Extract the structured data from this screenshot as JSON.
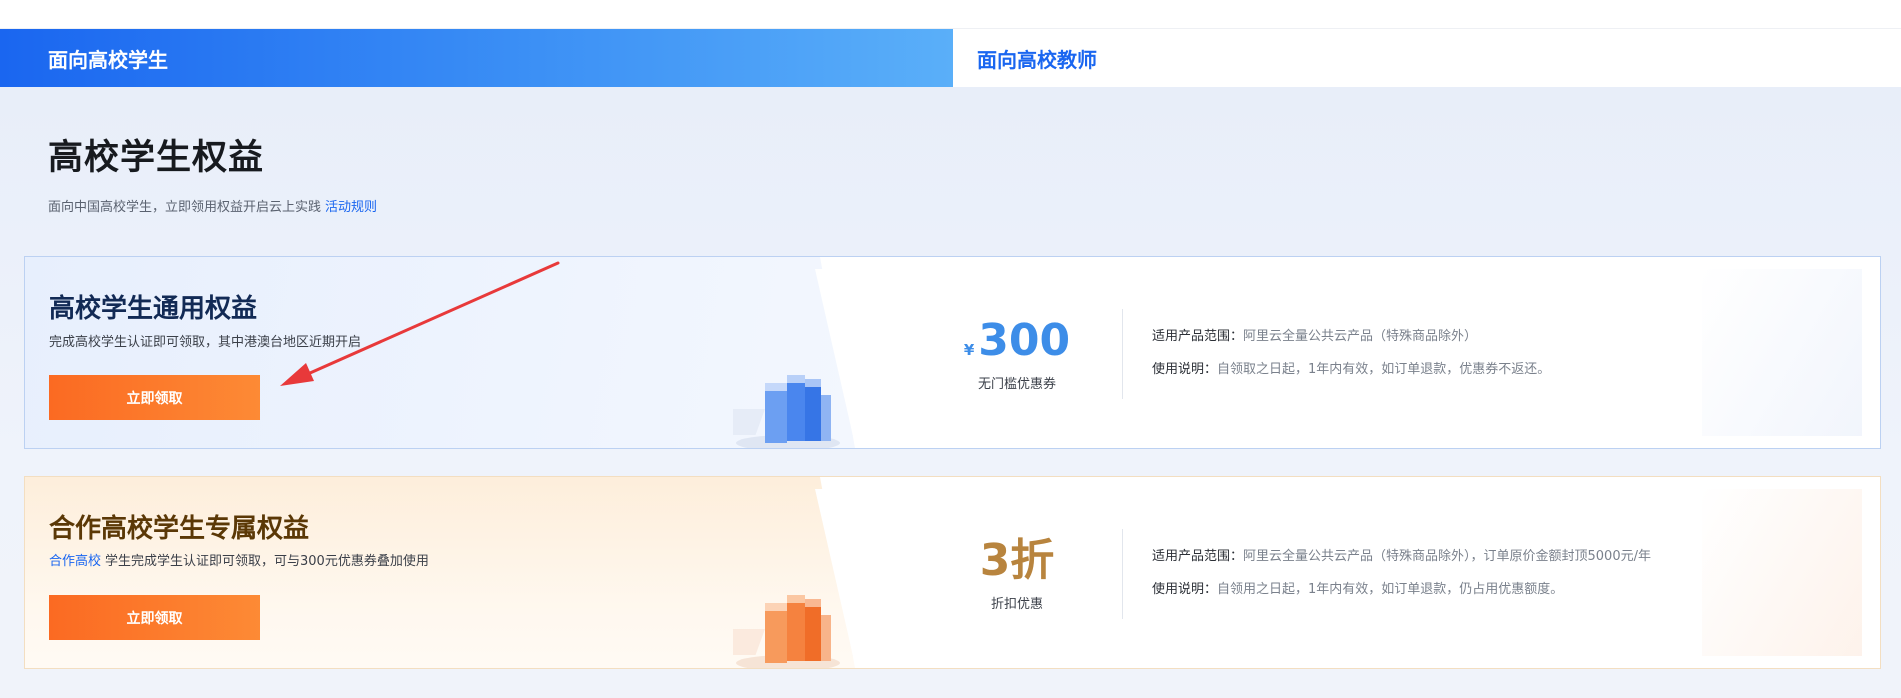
{
  "tabs": {
    "students": "面向高校学生",
    "teachers": "面向高校教师"
  },
  "page": {
    "title": "高校学生权益",
    "subtitle": "面向中国高校学生，立即领用权益开启云上实践",
    "rules_link": "活动规则"
  },
  "cards": [
    {
      "title": "高校学生通用权益",
      "desc": "完成高校学生认证即可领取，其中港澳台地区近期开启",
      "button": "立即领取",
      "currency": "¥",
      "value": "300",
      "value_label": "无门槛优惠券",
      "scope_label": "适用产品范围：",
      "scope_text": "阿里云全量公共云产品（特殊商品除外）",
      "usage_label": "使用说明：",
      "usage_text": "自领取之日起，1年内有效，如订单退款，优惠券不返还。"
    },
    {
      "title": "合作高校学生专属权益",
      "desc_highlight": "合作高校",
      "desc": "学生完成学生认证即可领取，可与300元优惠券叠加使用",
      "button": "立即领取",
      "value": "3折",
      "value_label": "折扣优惠",
      "scope_label": "适用产品范围：",
      "scope_text": "阿里云全量公共云产品（特殊商品除外），订单原价金额封顶5000元/年",
      "usage_label": "使用说明：",
      "usage_text": "自领用之日起，1年内有效，如订单退款，仍占用优惠额度。"
    }
  ],
  "colors": {
    "primary": "#1a66f0",
    "button_orange": "#fb6a22",
    "coupon_blue": "#3d8de8",
    "discount_gold": "#b8843e",
    "arrow_red": "#e8393a"
  }
}
